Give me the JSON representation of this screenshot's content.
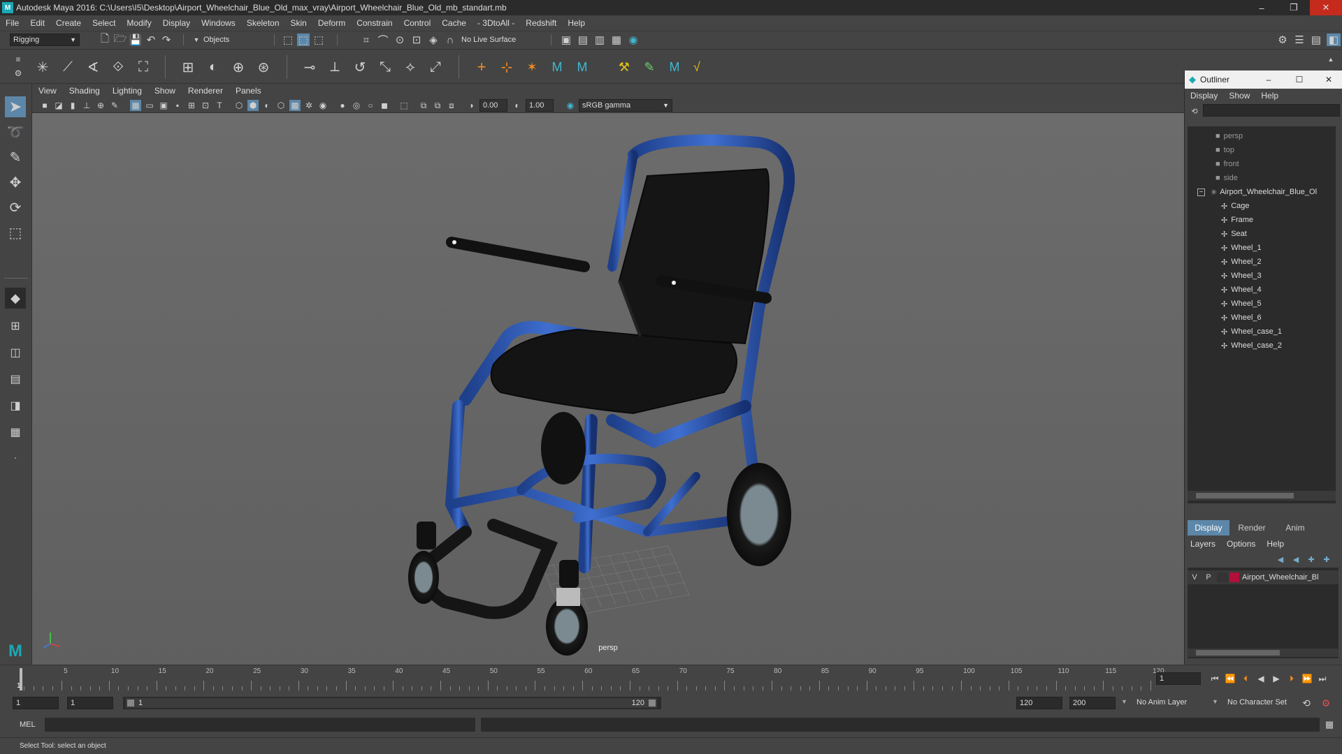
{
  "window": {
    "title": "Autodesk Maya 2016: C:\\Users\\I5\\Desktop\\Airport_Wheelchair_Blue_Old_max_vray\\Airport_Wheelchair_Blue_Old_mb_standart.mb",
    "minimize": "–",
    "restore": "❐",
    "close": "✕"
  },
  "menubar": [
    "File",
    "Edit",
    "Create",
    "Select",
    "Modify",
    "Display",
    "Windows",
    "Skeleton",
    "Skin",
    "Deform",
    "Constrain",
    "Control",
    "Cache",
    "- 3DtoAll -",
    "Redshift",
    "Help"
  ],
  "statusline": {
    "mode": "Rigging",
    "selection_mode": "Objects",
    "live_surface": "No Live Surface"
  },
  "viewport": {
    "menu": [
      "View",
      "Shading",
      "Lighting",
      "Show",
      "Renderer",
      "Panels"
    ],
    "exposure": "0.00",
    "gamma": "1.00",
    "color_space": "sRGB gamma",
    "camera_label": "persp"
  },
  "outliner": {
    "title": "Outliner",
    "menu": [
      "Display",
      "Show",
      "Help"
    ],
    "cameras": [
      "persp",
      "top",
      "front",
      "side"
    ],
    "root": "Airport_Wheelchair_Blue_Ol",
    "children": [
      "Cage",
      "Frame",
      "Seat",
      "Wheel_1",
      "Wheel_2",
      "Wheel_3",
      "Wheel_4",
      "Wheel_5",
      "Wheel_6",
      "Wheel_case_1",
      "Wheel_case_2"
    ]
  },
  "layers": {
    "tabs": [
      "Display",
      "Render",
      "Anim"
    ],
    "menu": [
      "Layers",
      "Options",
      "Help"
    ],
    "layer": {
      "v": "V",
      "p": "P",
      "name": "Airport_Wheelchair_Bl",
      "color": "#b0103a"
    }
  },
  "timeline": {
    "ticks": [
      "5",
      "10",
      "15",
      "20",
      "25",
      "30",
      "35",
      "40",
      "45",
      "50",
      "55",
      "60",
      "65",
      "70",
      "75",
      "80",
      "85",
      "90",
      "95",
      "100",
      "105",
      "110",
      "115",
      "120"
    ],
    "start_tick": "1",
    "current_frame": "1"
  },
  "range": {
    "start": "1",
    "playback_start": "1",
    "slider_start": "1",
    "slider_end": "120",
    "playback_end": "120",
    "end": "200",
    "anim_layer": "No Anim Layer",
    "character_set": "No Character Set"
  },
  "cmdline": {
    "label": "MEL"
  },
  "helpline": {
    "text": "Select Tool: select an object"
  }
}
